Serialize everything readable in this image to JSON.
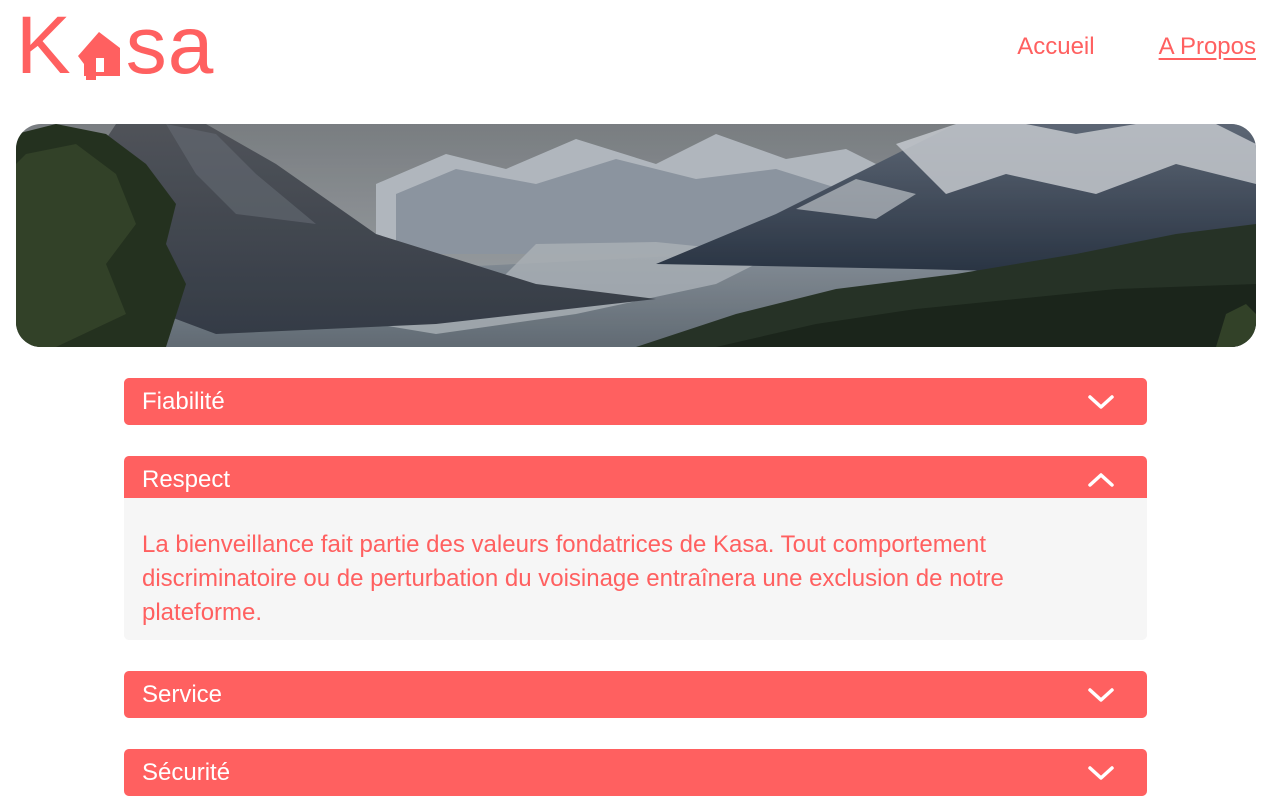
{
  "header": {
    "logo_text": "Kasa",
    "nav": [
      {
        "label": "Accueil",
        "active": false
      },
      {
        "label": "A Propos",
        "active": true
      }
    ]
  },
  "banner": {
    "alt": "Mountain valley landscape"
  },
  "collapses": [
    {
      "title": "Fiabilité",
      "open": false,
      "icon": "chevron-down-icon"
    },
    {
      "title": "Respect",
      "open": true,
      "icon": "chevron-up-icon",
      "content": "La bienveillance fait partie des valeurs fondatrices de Kasa. Tout comportement discriminatoire ou de perturbation du voisinage entraînera une exclusion de notre plateforme."
    },
    {
      "title": "Service",
      "open": false,
      "icon": "chevron-down-icon"
    },
    {
      "title": "Sécurité",
      "open": false,
      "icon": "chevron-down-icon"
    }
  ],
  "colors": {
    "accent": "#FF6060",
    "panel_bg": "#F6F6F6",
    "white": "#FFFFFF"
  }
}
